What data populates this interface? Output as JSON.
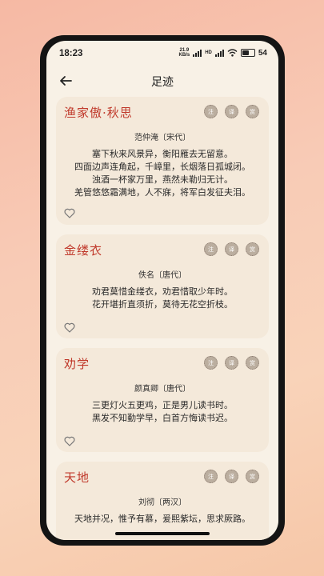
{
  "status_bar": {
    "time": "18:23",
    "net_speed_value": "21.9",
    "net_speed_unit": "KB/s",
    "hd_label": "HD",
    "battery_level": "54"
  },
  "header": {
    "title": "足迹",
    "back_icon": "arrow-left-icon"
  },
  "actions": {
    "seal_1": "注",
    "seal_2": "译",
    "seal_3": "赏"
  },
  "poems": [
    {
      "title": "渔家傲·秋思",
      "author": "范仲淹〔宋代〕",
      "lines": [
        "塞下秋来风景异，衡阳雁去无留意。",
        "四面边声连角起，千嶂里，长烟落日孤城闭。",
        "浊酒一杯家万里，燕然未勒归无计。",
        "羌管悠悠霜满地，人不寐，将军白发征夫泪。"
      ]
    },
    {
      "title": "金缕衣",
      "author": "佚名〔唐代〕",
      "lines": [
        "劝君莫惜金缕衣，劝君惜取少年时。",
        "花开堪折直须折，莫待无花空折枝。"
      ]
    },
    {
      "title": "劝学",
      "author": "颜真卿〔唐代〕",
      "lines": [
        "三更灯火五更鸡，正是男儿读书时。",
        "黑发不知勤学早，白首方悔读书迟。"
      ]
    },
    {
      "title": "天地",
      "author": "刘彻〔两汉〕",
      "lines": [
        "天地并况，惟予有慕，爰熙紫坛，思求厥路。"
      ]
    }
  ]
}
